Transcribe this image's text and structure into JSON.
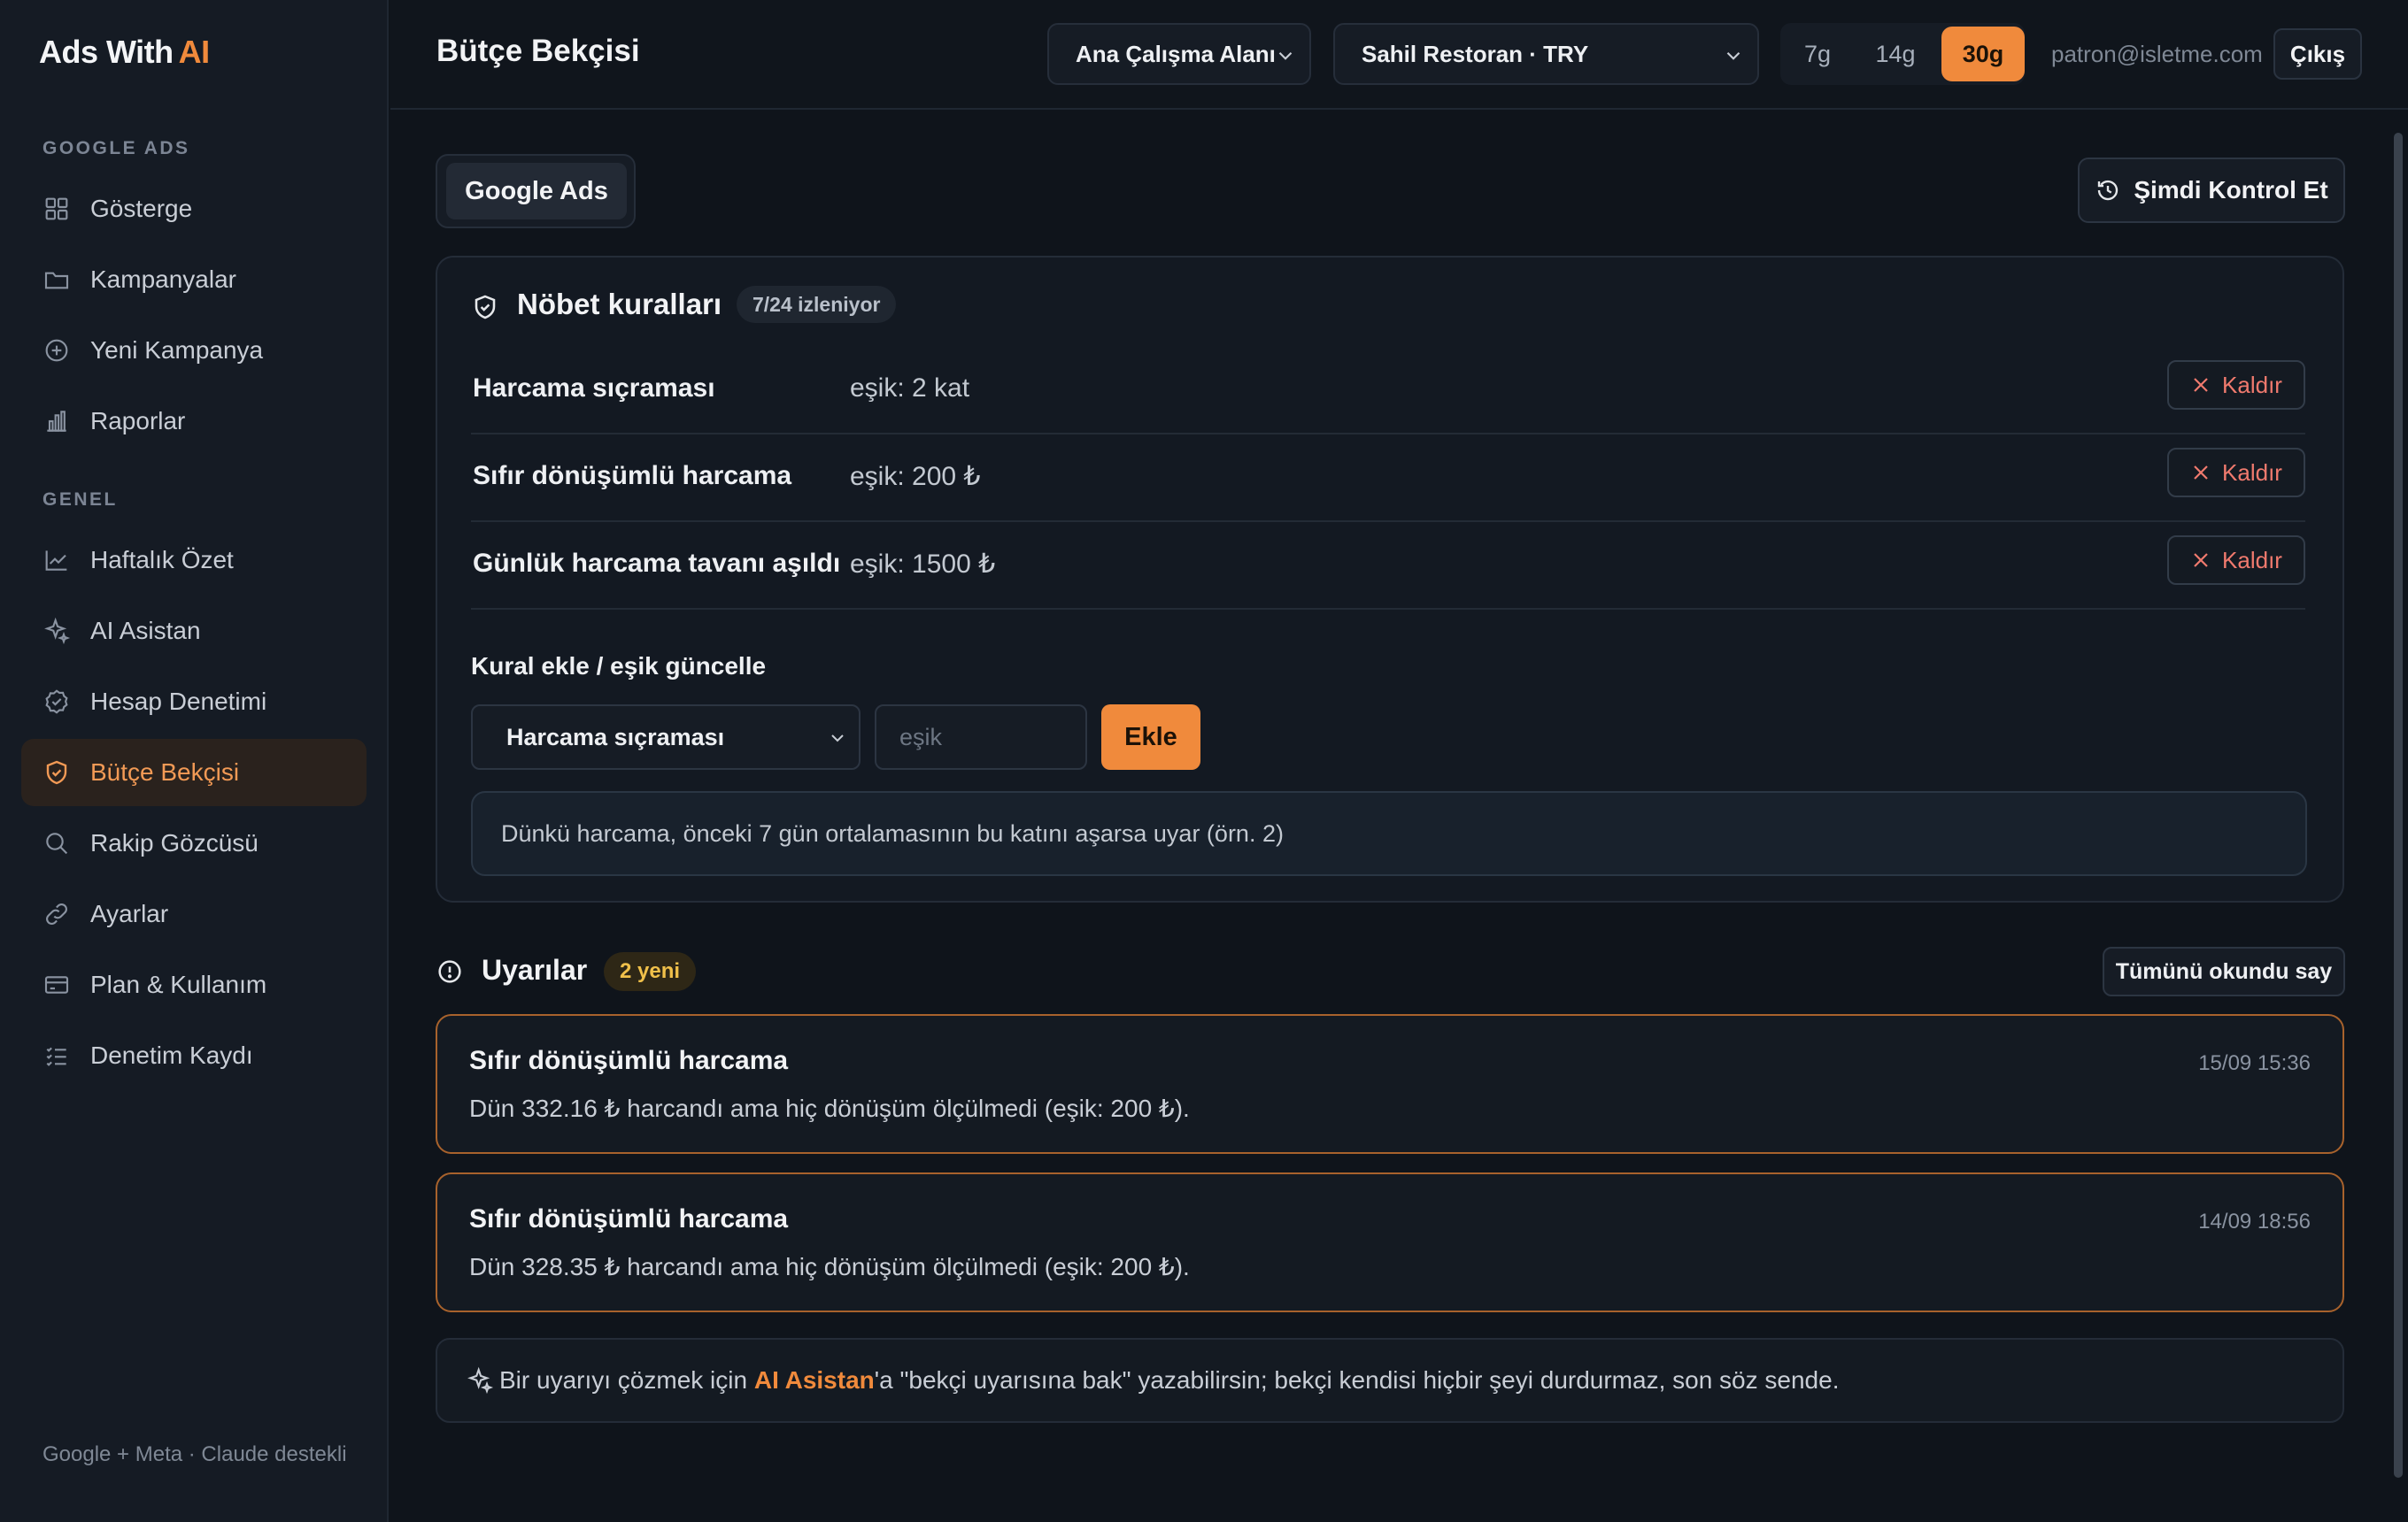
{
  "brand": {
    "name": "Ads With",
    "highlight": "AI"
  },
  "sidebar": {
    "sections": [
      {
        "label": "GOOGLE ADS"
      },
      {
        "label": "GENEL"
      }
    ],
    "items": [
      {
        "label": "Gösterge",
        "icon": "grid-icon"
      },
      {
        "label": "Kampanyalar",
        "icon": "folder-icon"
      },
      {
        "label": "Yeni Kampanya",
        "icon": "plus-circle-icon"
      },
      {
        "label": "Raporlar",
        "icon": "bar-chart-icon"
      },
      {
        "label": "Haftalık Özet",
        "icon": "line-chart-icon"
      },
      {
        "label": "AI Asistan",
        "icon": "sparkle-icon"
      },
      {
        "label": "Hesap Denetimi",
        "icon": "badge-check-icon"
      },
      {
        "label": "Bütçe Bekçisi",
        "icon": "shield-check-icon",
        "active": true
      },
      {
        "label": "Rakip Gözcüsü",
        "icon": "search-icon"
      },
      {
        "label": "Ayarlar",
        "icon": "link-icon"
      },
      {
        "label": "Plan & Kullanım",
        "icon": "credit-card-icon"
      },
      {
        "label": "Denetim Kaydı",
        "icon": "list-check-icon"
      }
    ],
    "footer": "Google + Meta · Claude destekli"
  },
  "header": {
    "title": "Bütçe Bekçisi",
    "workspace_select": "Ana Çalışma Alanı",
    "account_select": "Sahil Restoran · TRY",
    "ranges": [
      "7g",
      "14g",
      "30g"
    ],
    "active_range": "30g",
    "email": "patron@isletme.com",
    "logout": "Çıkış"
  },
  "main": {
    "tab": "Google Ads",
    "check_now": "Şimdi Kontrol Et",
    "rules_card": {
      "title": "Nöbet kuralları",
      "badge": "7/24 izleniyor",
      "rules": [
        {
          "name": "Harcama sıçraması",
          "threshold": "eşik: 2 kat",
          "remove": "Kaldır"
        },
        {
          "name": "Sıfır dönüşümlü harcama",
          "threshold": "eşik: 200 ₺",
          "remove": "Kaldır"
        },
        {
          "name": "Günlük harcama tavanı aşıldı",
          "threshold": "eşik: 1500 ₺",
          "remove": "Kaldır"
        }
      ],
      "add_title": "Kural ekle / eşik güncelle",
      "rule_select_value": "Harcama sıçraması",
      "threshold_placeholder": "eşik",
      "add_button": "Ekle",
      "hint": "Dünkü harcama, önceki 7 gün ortalamasının bu katını aşarsa uyar (örn. 2)"
    },
    "alerts": {
      "title": "Uyarılar",
      "badge": "2 yeni",
      "mark_all_read": "Tümünü okundu say",
      "items": [
        {
          "title": "Sıfır dönüşümlü harcama",
          "time": "15/09 15:36",
          "body": "Dün 332.16 ₺ harcandı ama hiç dönüşüm ölçülmedi (eşik: 200 ₺)."
        },
        {
          "title": "Sıfır dönüşümlü harcama",
          "time": "14/09 18:56",
          "body": "Dün 328.35 ₺ harcandı ama hiç dönüşüm ölçülmedi (eşik: 200 ₺)."
        }
      ]
    },
    "tip": {
      "before": "Bir uyarıyı çözmek için ",
      "link": "AI Asistan",
      "after": "'a \"bekçi uyarısına bak\" yazabilirsin; bekçi kendisi hiçbir şeyi durdurmaz, son söz sende."
    }
  },
  "colors": {
    "accent": "#f08a3c",
    "danger": "#f07a6e",
    "badge_new": "#f0c04a"
  }
}
